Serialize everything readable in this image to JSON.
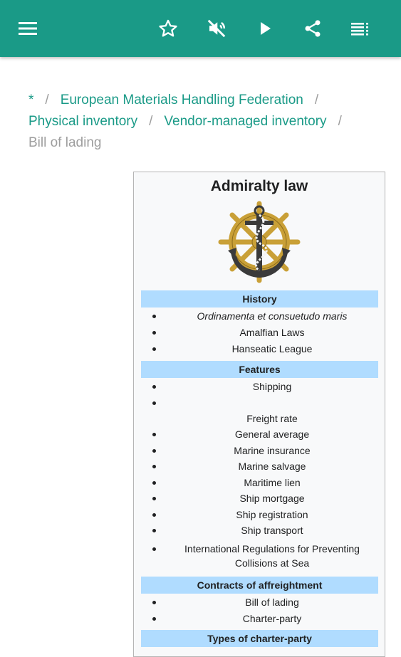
{
  "appbar": {
    "color": "#1a9a87",
    "icons": [
      "menu-icon",
      "star-icon",
      "mute-icon",
      "play-icon",
      "share-icon",
      "list-icon"
    ]
  },
  "breadcrumbs": {
    "items": [
      "*",
      "European Materials Handling Federation",
      "Physical inventory",
      "Vendor-managed inventory"
    ],
    "separator": "/",
    "current": "Bill of lading"
  },
  "infobox": {
    "title": "Admiralty law",
    "sections": [
      {
        "heading": "History",
        "items": [
          "Ordinamenta et consuetudo maris",
          "Amalfian Laws",
          "Hanseatic League"
        ]
      },
      {
        "heading": "Features",
        "items": [
          "Shipping",
          "",
          "Freight rate",
          "General average",
          "Marine insurance",
          "Marine salvage",
          "Maritime lien",
          "Ship mortgage",
          "Ship registration",
          "Ship transport",
          "International Regulations for Preventing Collisions at Sea"
        ]
      },
      {
        "heading": "Contracts of affreightment",
        "items": [
          "Bill of lading",
          "Charter-party"
        ]
      },
      {
        "heading": "Types of charter-party",
        "items": []
      }
    ]
  }
}
